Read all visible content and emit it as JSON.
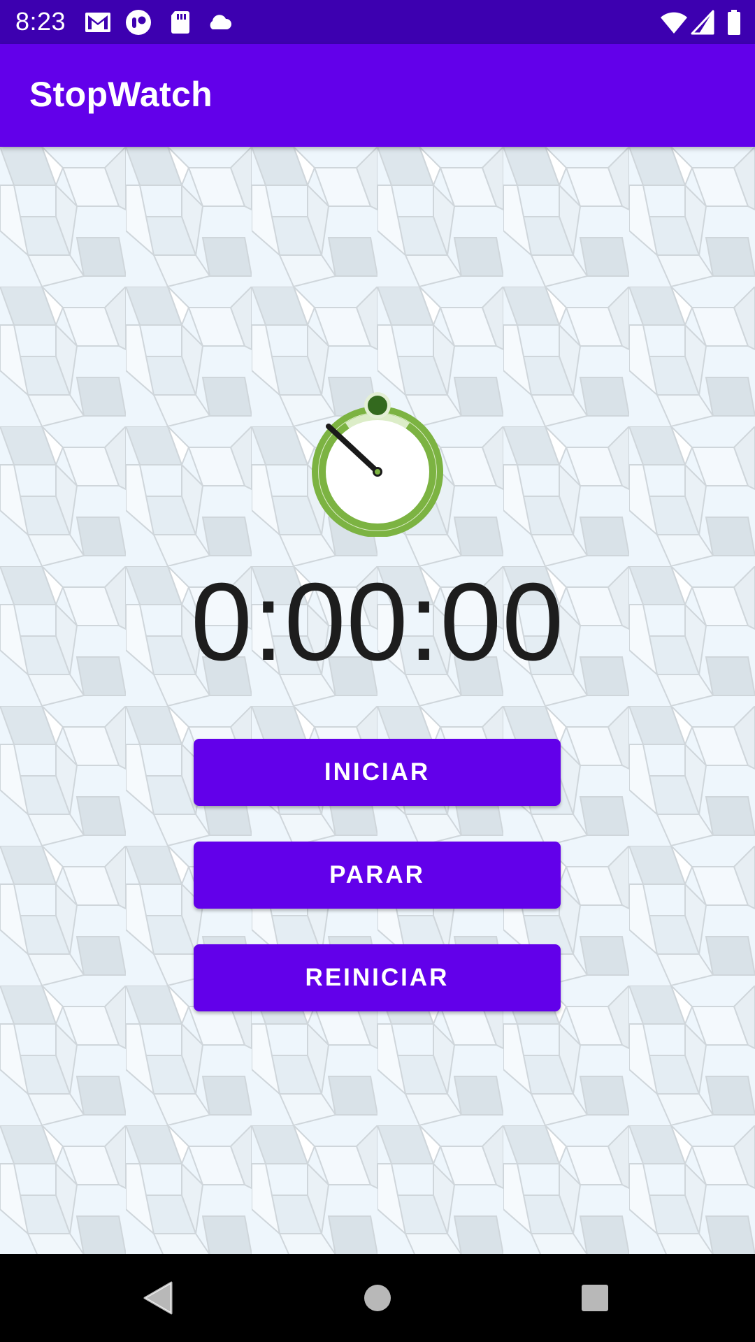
{
  "status_bar": {
    "time": "8:23",
    "left_icons": [
      "gmail-icon",
      "app-notification-icon",
      "sd-card-icon",
      "cloud-icon"
    ],
    "right_icons": [
      "wifi-icon",
      "cell-signal-icon",
      "battery-icon"
    ]
  },
  "app_bar": {
    "title": "StopWatch"
  },
  "main": {
    "icon": "stopwatch-icon",
    "time_display": "0:00:00",
    "buttons": {
      "start": "INICIAR",
      "stop": "PARAR",
      "reset": "REINICIAR"
    }
  },
  "nav_bar": {
    "items": [
      "back-icon",
      "home-icon",
      "recents-icon"
    ]
  },
  "colors": {
    "status_bar": "#3d00b0",
    "app_bar": "#6200ea",
    "button": "#6200ea",
    "stopwatch_ring": "#7cb342",
    "stopwatch_knob": "#33691e"
  }
}
